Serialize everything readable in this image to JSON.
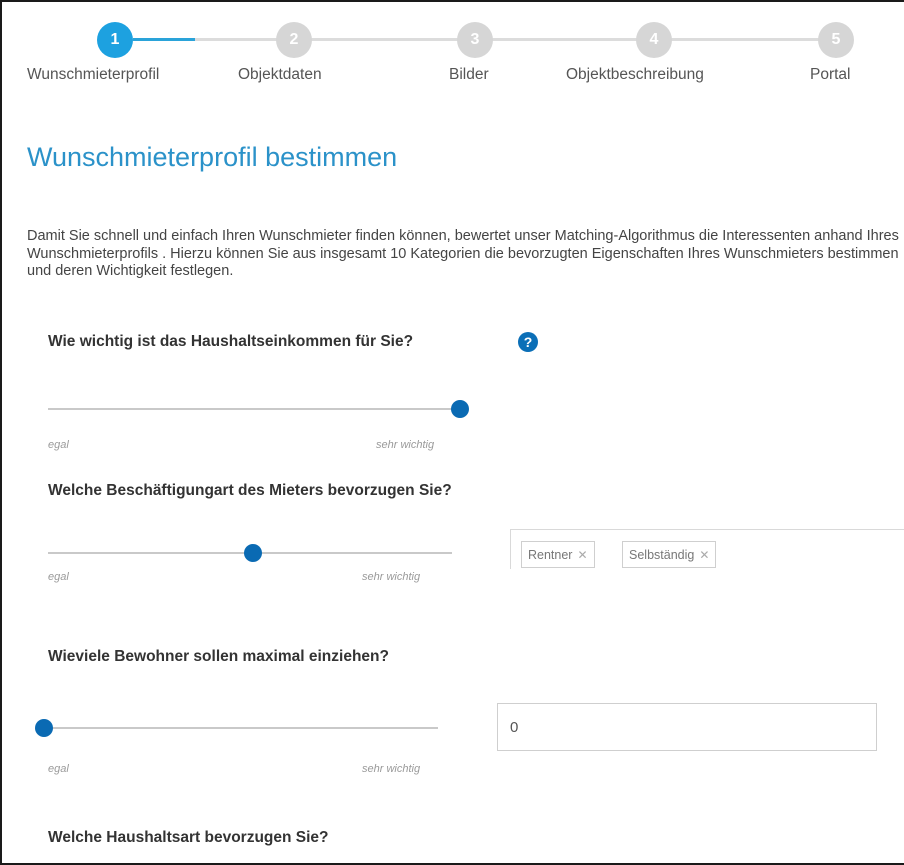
{
  "stepper": {
    "steps": [
      {
        "number": "1",
        "label": "Wunschmieterprofil",
        "state": "active"
      },
      {
        "number": "2",
        "label": "Objektdaten",
        "state": "inactive"
      },
      {
        "number": "3",
        "label": "Bilder",
        "state": "inactive"
      },
      {
        "number": "4",
        "label": "Objektbeschreibung",
        "state": "inactive"
      },
      {
        "number": "5",
        "label": "Portal",
        "state": "inactive"
      }
    ]
  },
  "main": {
    "title": "Wunschmieterprofil bestimmen",
    "intro": "Damit Sie schnell und einfach Ihren Wunschmieter finden können, bewertet unser Matching-Algorithmus die Interessenten anhand Ihres Wunschmieterprofils . Hierzu können Sie aus insgesamt 10 Kategorien die bevorzugten Eigenschaften Ihres Wunschmieters bestimmen und deren Wichtigkeit festlegen.",
    "questions": [
      {
        "text": "Wie wichtig ist das Haushaltseinkommen für Sie?",
        "slider_min": "egal",
        "slider_max": "sehr wichtig",
        "slider_value": 1.0
      },
      {
        "text": "Welche Beschäftigungart des Mieters bevorzugen Sie?",
        "slider_min": "egal",
        "slider_max": "sehr wichtig",
        "slider_value": 0.5,
        "tags": [
          "Rentner",
          "Selbständig"
        ]
      },
      {
        "text": "Wieviele Bewohner sollen maximal einziehen?",
        "slider_min": "egal",
        "slider_max": "sehr wichtig",
        "slider_value": 0.0,
        "input_value": "0"
      },
      {
        "text": "Welche Haushaltsart bevorzugen Sie?"
      }
    ]
  },
  "icons": {
    "help": "question-circle-icon",
    "tag_remove": "close-icon"
  },
  "colors": {
    "accent": "#1da1e0",
    "title": "#2b92c9",
    "slider_thumb": "#0a6ab3",
    "help_icon": "#0b6fb7",
    "step_inactive": "#d6d6d6"
  }
}
